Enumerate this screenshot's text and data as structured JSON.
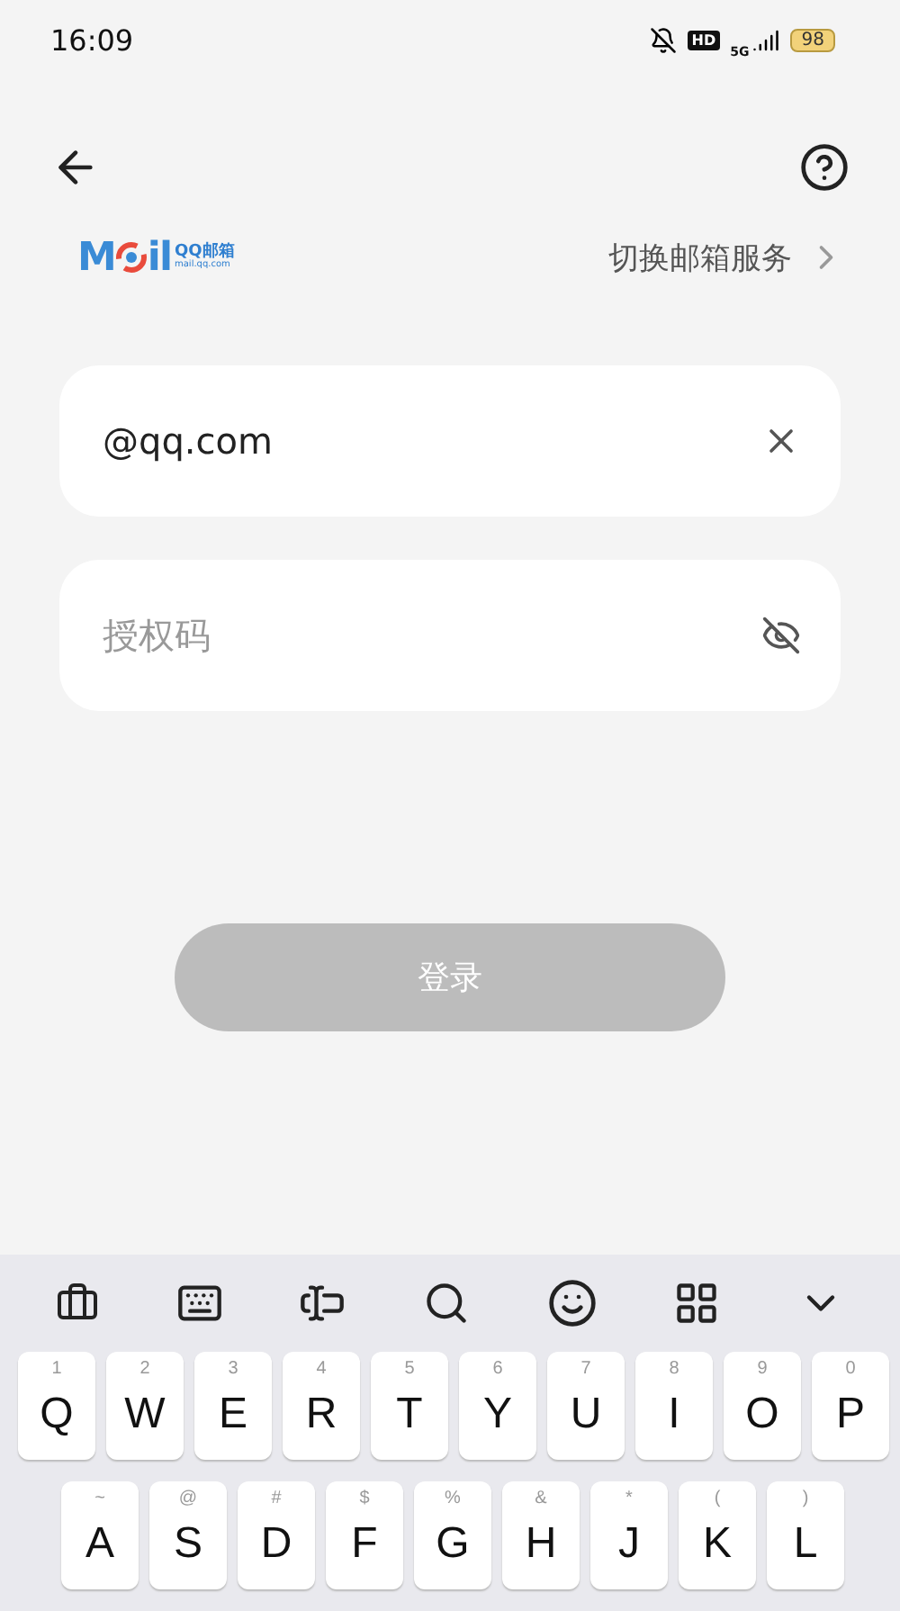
{
  "status_bar": {
    "time": "16:09",
    "hd": "HD",
    "network": "5G",
    "battery": "98"
  },
  "logo": {
    "mark_left": "M",
    "mark_right": "il",
    "brand": "QQ邮箱",
    "url": "mail.qq.com"
  },
  "switch_service": "切换邮箱服务",
  "email_field": {
    "value": "@qq.com"
  },
  "password_field": {
    "placeholder": "授权码"
  },
  "login_button": {
    "label": "登录",
    "disabled": true
  },
  "keyboard": {
    "rows": [
      [
        {
          "label": "Q",
          "hint": "1"
        },
        {
          "label": "W",
          "hint": "2"
        },
        {
          "label": "E",
          "hint": "3"
        },
        {
          "label": "R",
          "hint": "4"
        },
        {
          "label": "T",
          "hint": "5"
        },
        {
          "label": "Y",
          "hint": "6"
        },
        {
          "label": "U",
          "hint": "7"
        },
        {
          "label": "I",
          "hint": "8"
        },
        {
          "label": "O",
          "hint": "9"
        },
        {
          "label": "P",
          "hint": "0"
        }
      ],
      [
        {
          "label": "A",
          "hint": "~"
        },
        {
          "label": "S",
          "hint": "@"
        },
        {
          "label": "D",
          "hint": "#"
        },
        {
          "label": "F",
          "hint": "$"
        },
        {
          "label": "G",
          "hint": "%"
        },
        {
          "label": "H",
          "hint": "&"
        },
        {
          "label": "J",
          "hint": "*"
        },
        {
          "label": "K",
          "hint": "("
        },
        {
          "label": "L",
          "hint": ")"
        }
      ]
    ]
  }
}
